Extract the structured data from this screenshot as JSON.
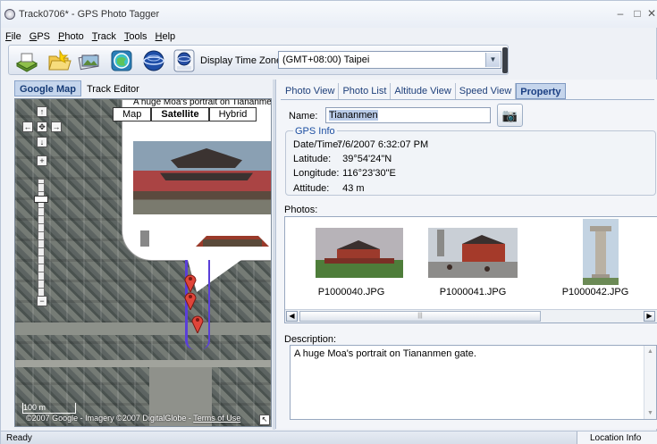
{
  "window": {
    "title": "Track0706* - GPS Photo Tagger",
    "minimize": "–",
    "maximize": "□",
    "close": "✕"
  },
  "menu": [
    "File",
    "GPS",
    "Photo",
    "Track",
    "Tools",
    "Help"
  ],
  "toolbar": {
    "icons": [
      "open-track-icon",
      "open-folder-icon",
      "import-photos-icon",
      "web-globe-icon",
      "earth-icon",
      "kmz-export-icon"
    ],
    "timezone_label": "Display Time Zone:",
    "timezone_value": "(GMT+08:00) Taipei"
  },
  "left_tabs": [
    {
      "label": "Google Map",
      "active": true
    },
    {
      "label": "Track Editor",
      "active": false
    }
  ],
  "map": {
    "types": [
      "Map",
      "Satellite",
      "Hybrid"
    ],
    "selected_type": "Satellite",
    "popup_text": "A huge Moa's portrait on Tiananmen g",
    "scale_label": "100 m",
    "copyright": "©2007 Google - Imagery ©2007 DigitalGlobe",
    "terms": "Terms of Use"
  },
  "right_tabs": [
    {
      "label": "Photo View",
      "active": false
    },
    {
      "label": "Photo List",
      "active": false
    },
    {
      "label": "Altitude View",
      "active": false
    },
    {
      "label": "Speed View",
      "active": false
    },
    {
      "label": "Property",
      "active": true
    }
  ],
  "property": {
    "name_label": "Name:",
    "name_value": "Tiananmen",
    "gps_title": "GPS Info",
    "gps": [
      {
        "key": "Date/Time:",
        "value": "7/6/2007 6:32:07 PM"
      },
      {
        "key": "Latitude:",
        "value": "39°54'24\"N"
      },
      {
        "key": "Longitude:",
        "value": "116°23'30\"E"
      },
      {
        "key": "Attitude:",
        "value": "43 m"
      }
    ],
    "photos_label": "Photos:",
    "photos": [
      "P1000040.JPG",
      "P1000041.JPG",
      "P1000042.JPG"
    ],
    "description_label": "Description:",
    "description": "A huge Moa's portrait on Tiananmen gate."
  },
  "status": {
    "left": "Ready",
    "right": "Location Info"
  }
}
